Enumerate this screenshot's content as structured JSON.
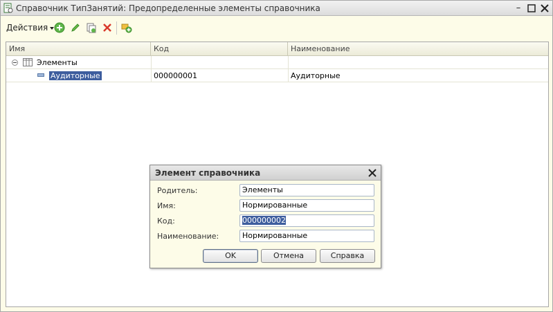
{
  "window": {
    "title": "Справочник ТипЗанятий: Предопределенные элементы справочника"
  },
  "toolbar": {
    "actions_label": "Действия",
    "icons": [
      "add-icon",
      "edit-icon",
      "copy-icon",
      "delete-icon",
      "add-group-icon"
    ]
  },
  "grid": {
    "columns": [
      "Имя",
      "Код",
      "Наименование"
    ],
    "rows": [
      {
        "name": "Элементы",
        "code": "",
        "description": ""
      },
      {
        "name": "Аудиторные",
        "code": "000000001",
        "description": "Аудиторные"
      }
    ]
  },
  "dialog": {
    "title": "Элемент справочника",
    "fields": [
      {
        "label": "Родитель:",
        "value": "Элементы"
      },
      {
        "label": "Имя:",
        "value": "Нормированные"
      },
      {
        "label": "Код:",
        "value": "000000002"
      },
      {
        "label": "Наименование:",
        "value": "Нормированные"
      }
    ],
    "buttons": {
      "ok": "OK",
      "cancel": "Отмена",
      "help": "Справка"
    }
  },
  "colors": {
    "window_bg": "#fdfce8",
    "selection": "#3d5d9e"
  }
}
